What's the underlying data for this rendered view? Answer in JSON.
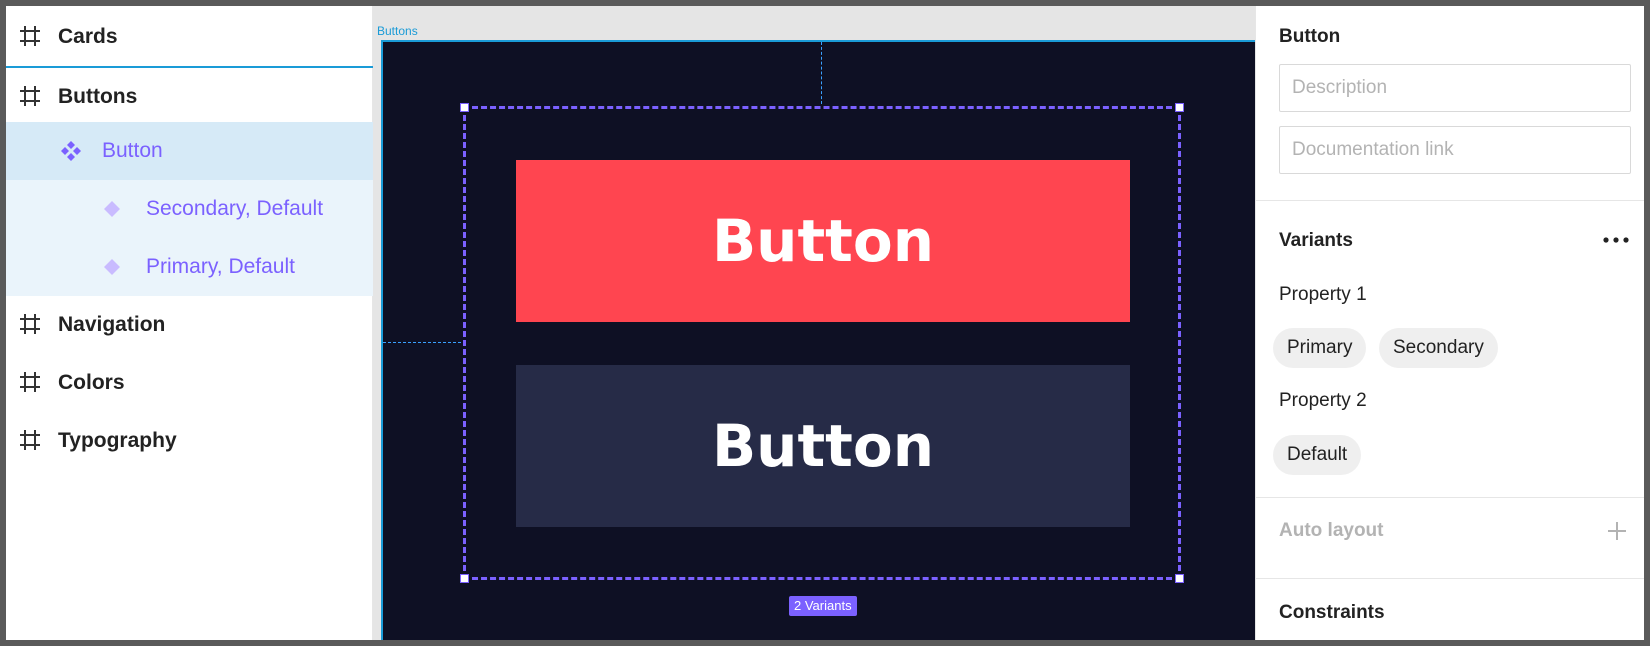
{
  "layers": {
    "items": [
      {
        "label": "Cards",
        "type": "frame"
      },
      {
        "label": "Buttons",
        "type": "frame"
      },
      {
        "label": "Button",
        "type": "component-set"
      },
      {
        "label": "Secondary, Default",
        "type": "variant"
      },
      {
        "label": "Primary, Default",
        "type": "variant"
      },
      {
        "label": "Navigation",
        "type": "frame"
      },
      {
        "label": "Colors",
        "type": "frame"
      },
      {
        "label": "Typography",
        "type": "frame"
      }
    ]
  },
  "canvas": {
    "frame_label": "Buttons",
    "primary_button_text": "Button",
    "secondary_button_text": "Button",
    "variants_badge": "2 Variants",
    "colors": {
      "primary": "#ff4550",
      "secondary": "#262b47",
      "frame_bg": "#0e1024",
      "selection": "#7b61ff"
    }
  },
  "properties": {
    "title": "Button",
    "description_placeholder": "Description",
    "doc_link_placeholder": "Documentation link",
    "variants": {
      "title": "Variants",
      "property1": {
        "label": "Property 1",
        "values": [
          "Primary",
          "Secondary"
        ]
      },
      "property2": {
        "label": "Property 2",
        "values": [
          "Default"
        ]
      }
    },
    "auto_layout": "Auto layout",
    "constraints": "Constraints"
  }
}
